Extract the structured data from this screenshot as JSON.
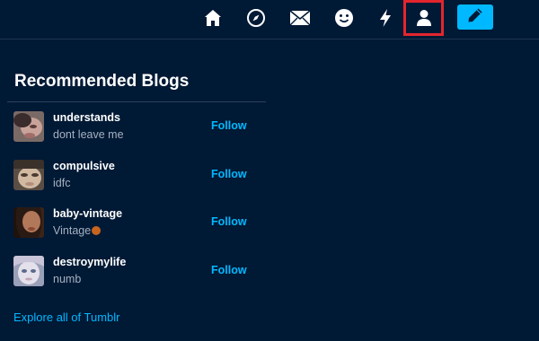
{
  "nav": {
    "icons": [
      "home-icon",
      "explore-icon",
      "inbox-icon",
      "messaging-icon",
      "activity-icon",
      "account-icon"
    ],
    "compose_icon": "pencil-icon",
    "highlight_color": "#e3262e",
    "accent": "#00b8ff"
  },
  "recommended": {
    "title": "Recommended Blogs",
    "follow_label": "Follow",
    "blogs": [
      {
        "name": "understands",
        "description": "dont leave me"
      },
      {
        "name": "compulsive",
        "description": "idfc"
      },
      {
        "name": "baby-vintage",
        "description": "Vintage"
      },
      {
        "name": "destroymylife",
        "description": "numb"
      }
    ],
    "explore_label": "Explore all of Tumblr"
  }
}
